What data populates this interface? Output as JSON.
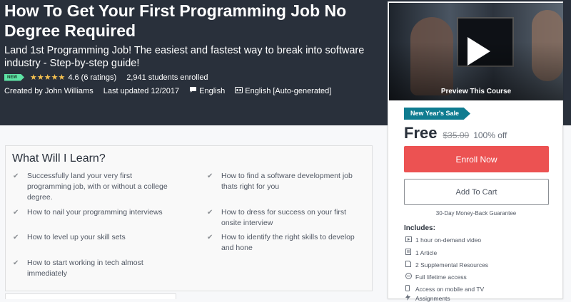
{
  "course": {
    "title": "How To Get Your First Programming Job No Degree Required",
    "subtitle": "Land 1st Programming Job! The easiest and fastest way to break into software industry - Step-by-step guide!",
    "badge": "NEW",
    "stars": "★★★★★",
    "rating": "4.6 (6 ratings)",
    "students": "2,941 students enrolled",
    "created_by": "Created by John Williams",
    "last_updated": "Last updated 12/2017",
    "language": "English",
    "captions": "English [Auto-generated]"
  },
  "learn": {
    "heading": "What Will I Learn?",
    "items": [
      "Successfully land your very first programming job, with or without a college degree.",
      "How to find a software development job thats right for you",
      "How to nail your programming interviews",
      "How to dress for success on your first onsite interview",
      "How to level up your skill sets",
      "How to identify the right skills to develop and hone",
      "How to start working in tech almost immediately"
    ]
  },
  "sidebar": {
    "preview_label": "Preview This Course",
    "sale_tag": "New Year's Sale",
    "price": "Free",
    "old_price": "$35.00",
    "discount": "100% off",
    "enroll_label": "Enroll Now",
    "cart_label": "Add To Cart",
    "guarantee": "30-Day Money-Back Guarantee",
    "includes_heading": "Includes:",
    "includes": [
      {
        "icon": "video-icon",
        "text": "1 hour on-demand video"
      },
      {
        "icon": "article-icon",
        "text": "1 Article"
      },
      {
        "icon": "resource-icon",
        "text": "2 Supplemental Resources"
      },
      {
        "icon": "infinity-icon",
        "text": "Full lifetime access"
      },
      {
        "icon": "mobile-icon",
        "text": "Access on mobile and TV"
      },
      {
        "icon": "assignment-icon",
        "text": "Assignments"
      }
    ]
  },
  "colors": {
    "hero_bg": "#29303b",
    "enroll": "#ec5252",
    "sale_tag": "#0f7c90",
    "new_badge": "#5ee3a5",
    "stars": "#f4c150"
  }
}
